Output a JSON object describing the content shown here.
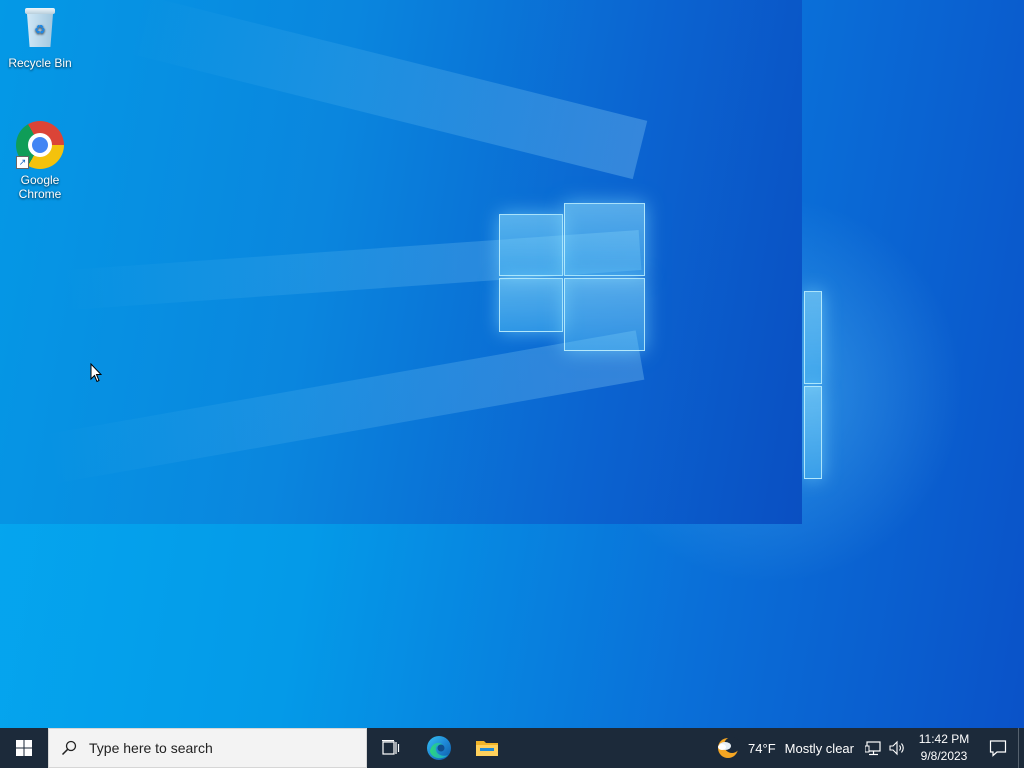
{
  "desktop": {
    "icons": [
      {
        "label": "Recycle Bin",
        "icon": "recycle-bin-icon"
      },
      {
        "label": "Google Chrome",
        "icon": "chrome-icon"
      }
    ],
    "wallpaper": "windows-10-hero"
  },
  "taskbar": {
    "search_placeholder": "Type here to search",
    "pinned": [
      {
        "name": "Task View",
        "icon": "task-view-icon"
      },
      {
        "name": "Microsoft Edge",
        "icon": "edge-icon"
      },
      {
        "name": "File Explorer",
        "icon": "file-explorer-icon"
      }
    ],
    "weather": {
      "temp": "74°F",
      "condition": "Mostly clear",
      "icon": "moon-cloud-icon"
    },
    "tray": [
      "network-icon",
      "volume-icon"
    ],
    "clock": {
      "time": "11:42 PM",
      "date": "9/8/2023"
    },
    "colors": {
      "taskbar": "#1c2a3a",
      "accent": "#0a78d7"
    }
  }
}
